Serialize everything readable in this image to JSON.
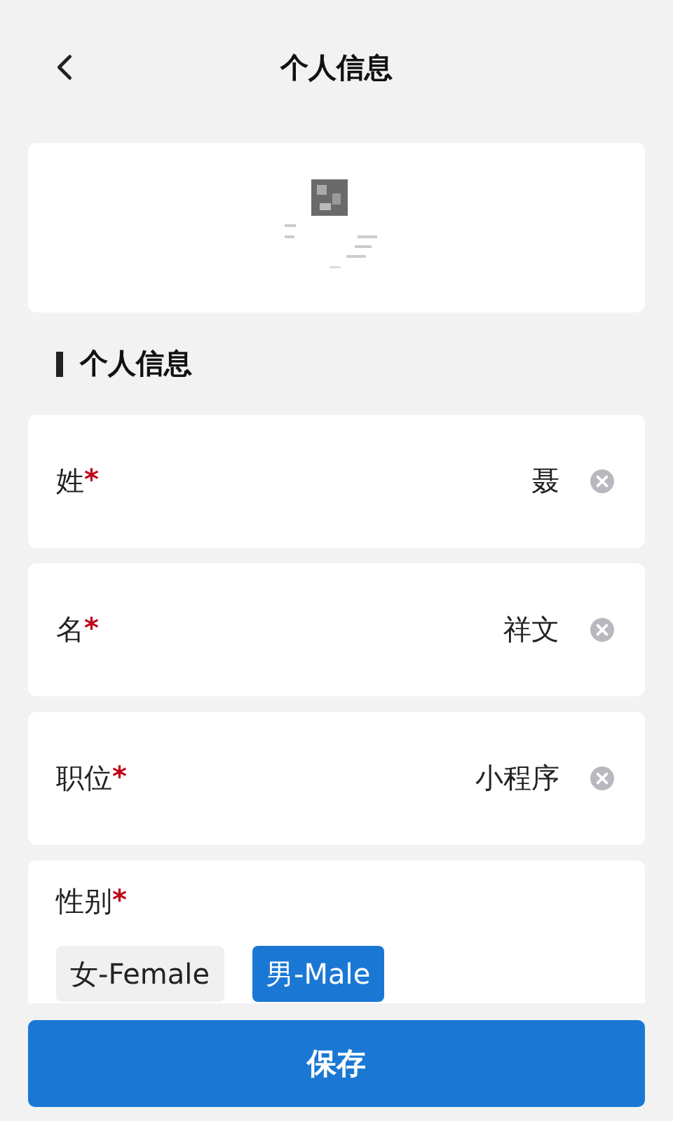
{
  "header": {
    "title": "个人信息"
  },
  "section": {
    "title": "个人信息"
  },
  "fields": [
    {
      "label": "姓",
      "required_mark": "*",
      "value": "聂"
    },
    {
      "label": "名",
      "required_mark": "*",
      "value": "祥文"
    },
    {
      "label": "职位",
      "required_mark": "*",
      "value": "小程序"
    }
  ],
  "gender": {
    "label": "性别",
    "required_mark": "*",
    "options": [
      {
        "label": "女-Female",
        "selected": false
      },
      {
        "label": "男-Male",
        "selected": true
      }
    ]
  },
  "save_button": {
    "label": "保存"
  }
}
